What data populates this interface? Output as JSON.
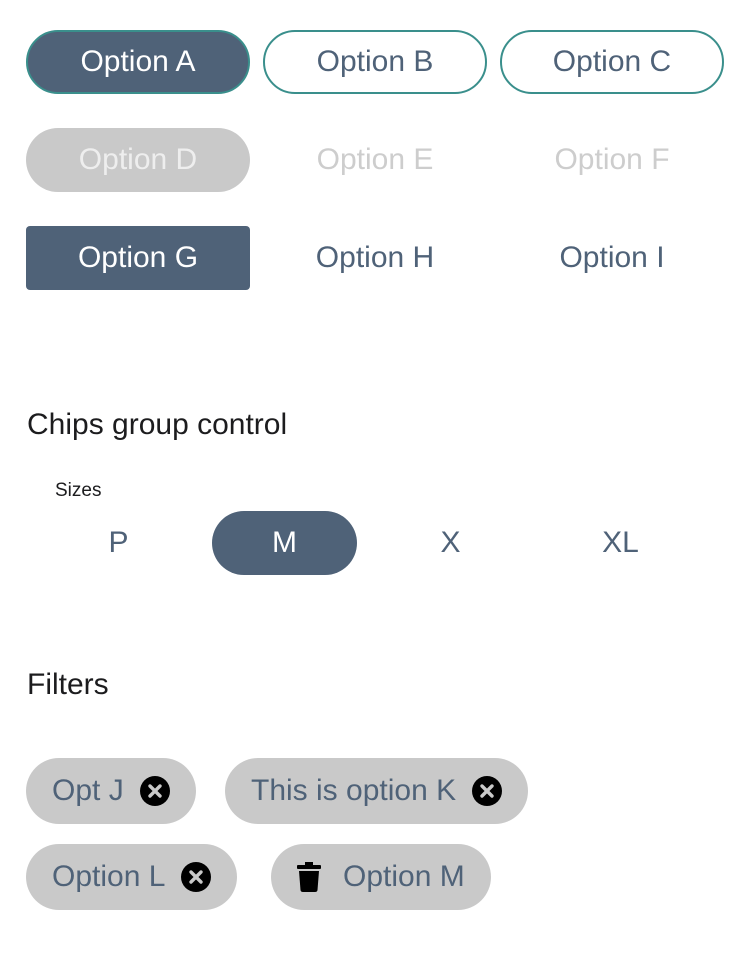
{
  "buttons": {
    "row1": [
      "Option A",
      "Option B",
      "Option C"
    ],
    "row2": [
      "Option D",
      "Option E",
      "Option F"
    ],
    "row3": [
      "Option G",
      "Option H",
      "Option I"
    ]
  },
  "chips_group": {
    "title": "Chips group control",
    "label": "Sizes",
    "options": [
      "P",
      "M",
      "X",
      "XL"
    ],
    "selected": "M"
  },
  "filters": {
    "title": "Filters",
    "chips": [
      {
        "label": "Opt J",
        "icon": "close-icon"
      },
      {
        "label": "This is option K",
        "icon": "close-icon"
      },
      {
        "label": "Option L",
        "icon": "close-icon"
      },
      {
        "label": "Option M",
        "icon": "trash-icon"
      }
    ]
  },
  "colors": {
    "accent": "#4f6278",
    "outline": "#3a8f8c",
    "chip_gray": "#c9c9c9",
    "disabled_text": "#cdcdcd"
  }
}
